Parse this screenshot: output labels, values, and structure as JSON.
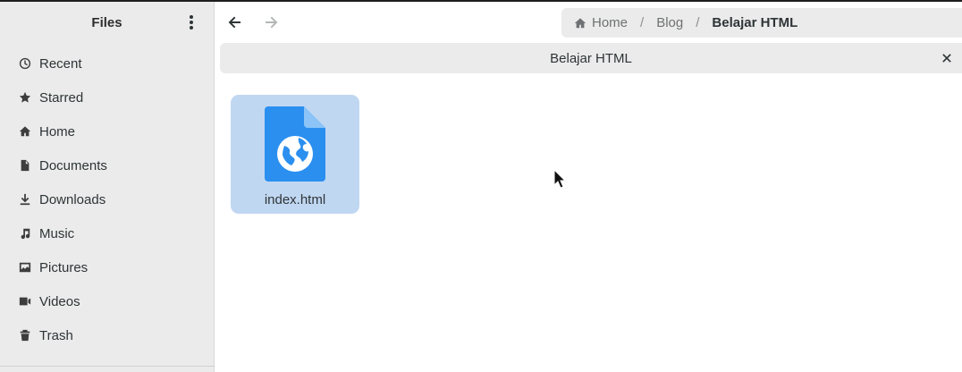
{
  "sidebar": {
    "title": "Files",
    "items": [
      {
        "label": "Recent",
        "icon": "clock-icon"
      },
      {
        "label": "Starred",
        "icon": "star-icon"
      },
      {
        "label": "Home",
        "icon": "home-icon"
      },
      {
        "label": "Documents",
        "icon": "document-icon"
      },
      {
        "label": "Downloads",
        "icon": "download-icon"
      },
      {
        "label": "Music",
        "icon": "music-icon"
      },
      {
        "label": "Pictures",
        "icon": "picture-icon"
      },
      {
        "label": "Videos",
        "icon": "video-icon"
      },
      {
        "label": "Trash",
        "icon": "trash-icon"
      }
    ]
  },
  "pathbar": {
    "crumbs": [
      "Home",
      "Blog",
      "Belajar HTML"
    ],
    "separator": "/"
  },
  "infobar": {
    "title": "Belajar HTML"
  },
  "files": [
    {
      "name": "index.html",
      "icon": "html-file-icon",
      "selected": true
    }
  ],
  "colors": {
    "selection": "#c0d7f2",
    "file_icon_blue": "#2b8ff0",
    "sidebar_bg": "#ebebeb"
  }
}
